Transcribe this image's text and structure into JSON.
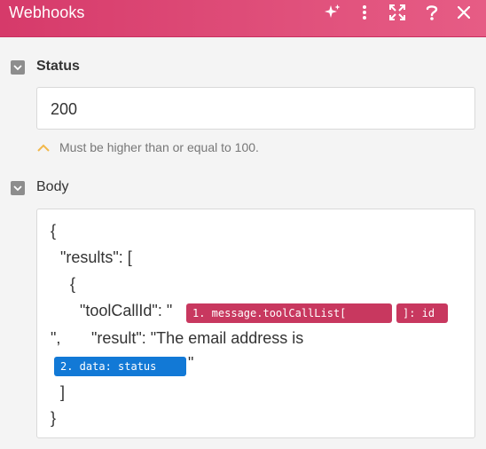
{
  "header": {
    "title": "Webhooks",
    "icons": [
      "sparkle-icon",
      "more-vertical-icon",
      "expand-icon",
      "help-icon",
      "close-icon"
    ],
    "color": "#dd4a76"
  },
  "status": {
    "label": "Status",
    "value": "200",
    "hint": "Must be higher than or equal to 100."
  },
  "body": {
    "label": "Body",
    "lines": {
      "l1": "{",
      "l2": "\"results\": [",
      "l3": "{",
      "l4_text": "\"toolCallId\": \"",
      "l5_text": "\",",
      "l5_result": "\"result\": \"The email address is",
      "l6_quote": "\"",
      "l7": "]",
      "l8": "}"
    },
    "pills": {
      "message_tool_call_list": "1. message.toolCallList[",
      "id": "]: id",
      "data_status": "2. data: status"
    },
    "pill_colors": {
      "module1": "#c8385f",
      "module2": "#1279d6"
    }
  }
}
